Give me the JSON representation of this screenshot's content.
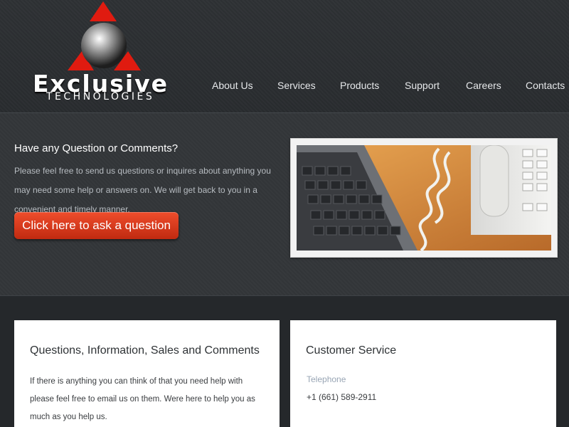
{
  "brand": {
    "name": "Exclusive",
    "tagline": "TECHNOLOGIES"
  },
  "nav": {
    "items": [
      {
        "label": "About Us"
      },
      {
        "label": "Services"
      },
      {
        "label": "Products"
      },
      {
        "label": "Support"
      },
      {
        "label": "Careers"
      },
      {
        "label": "Contacts"
      }
    ]
  },
  "hero": {
    "title": "Have any Question or Comments?",
    "text": "Please feel free to send us questions or inquires about anything you may need some help or answers on. We will get back to you in a convenient and timely manner.",
    "button_label": "Click here to ask a question",
    "image_icon": "keyboard-and-phone-photo"
  },
  "cards": [
    {
      "title": "Questions, Information, Sales and Comments",
      "text": "If there is anything you can think of that you need help with please feel free to email us on them. Were here to help you as much as you help us."
    },
    {
      "title": "Customer Service",
      "label": "Telephone",
      "value": "+1 (661) 589-2911"
    }
  ],
  "colors": {
    "accent": "#e03a1c",
    "background": "#2b2e31",
    "card": "#ffffff",
    "label": "#98a5b4"
  }
}
